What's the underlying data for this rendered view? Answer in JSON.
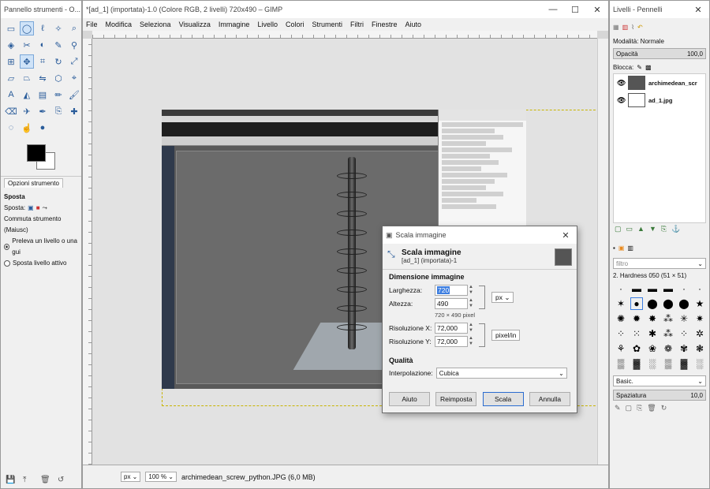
{
  "toolbox": {
    "title": "Pannello strumenti - O...",
    "tab_label": "Opzioni strumento",
    "tool_name": "Sposta",
    "move_label": "Sposta:",
    "toggle_label": "Commuta strumento (Maiusc)",
    "opt1": "Preleva un livello o una gui",
    "opt2": "Sposta livello attivo"
  },
  "main": {
    "title": "*[ad_1] (importata)-1.0 (Colore RGB, 2 livelli) 720x490 – GIMP",
    "menu": [
      "File",
      "Modifica",
      "Seleziona",
      "Visualizza",
      "Immagine",
      "Livello",
      "Colori",
      "Strumenti",
      "Filtri",
      "Finestre",
      "Aiuto"
    ],
    "status": {
      "unit": "px",
      "zoom": "100 %",
      "file": "archimedean_screw_python.JPG (6,0 MB)"
    }
  },
  "dialog": {
    "title": "Scala immagine",
    "heading": "Scala immagine",
    "subheading": "[ad_1] (importata)-1",
    "section_size": "Dimensione immagine",
    "width_label": "Larghezza:",
    "width_value": "720",
    "height_label": "Altezza:",
    "height_value": "490",
    "size_unit": "px",
    "pixel_note": "720 × 490 pixel",
    "resx_label": "Risoluzione X:",
    "resx_value": "72,000",
    "resy_label": "Risoluzione Y:",
    "resy_value": "72,000",
    "res_unit": "pixel/in",
    "section_quality": "Qualità",
    "interp_label": "Interpolazione:",
    "interp_value": "Cubica",
    "buttons": {
      "help": "Aiuto",
      "reset": "Reimposta",
      "scale": "Scala",
      "cancel": "Annulla"
    }
  },
  "dock": {
    "title": "Livelli - Pennelli",
    "mode": "Modalità: Normale",
    "opacity_label": "Opacità",
    "opacity_value": "100,0",
    "lock_label": "Blocca:",
    "layers": [
      {
        "name": "archimedean_scr"
      },
      {
        "name": "ad_1.jpg"
      }
    ],
    "filter_placeholder": "filtro",
    "brush_name": "2. Hardness 050 (51 × 51)",
    "brush_set": "Basic.",
    "spacing_label": "Spaziatura",
    "spacing_value": "10,0"
  }
}
